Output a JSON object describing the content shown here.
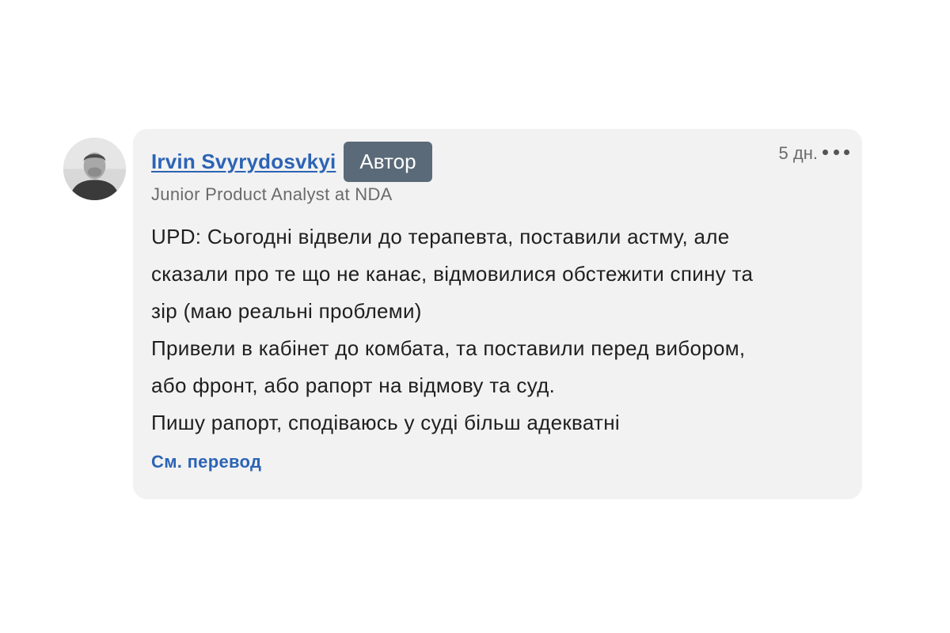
{
  "comment": {
    "author": {
      "name": "Irvin Svyrydosvkyi",
      "badge": "Автор",
      "headline": "Junior Product Analyst at NDA",
      "avatar_icon": "user-photo"
    },
    "timestamp": "5 дн.",
    "more_icon": "more-horizontal-icon",
    "body_lines": [
      "UPD: Сьогодні відвели до терапевта, поставили астму, але",
      "сказали про те що не канає, відмовилися обстежити спину та",
      "зір (маю реальні проблеми)",
      "Привели в кабінет до комбата, та поставили перед вибором,",
      "або фронт, або рапорт на відмову та суд.",
      "Пишу рапорт, сподіваюсь у суді більш адекватні"
    ],
    "translate_label": "См. перевод"
  },
  "colors": {
    "card_background": "#f2f2f2",
    "link": "#2c64b5",
    "badge_background": "#5b6a78",
    "secondary_text": "#6b6b6b"
  }
}
